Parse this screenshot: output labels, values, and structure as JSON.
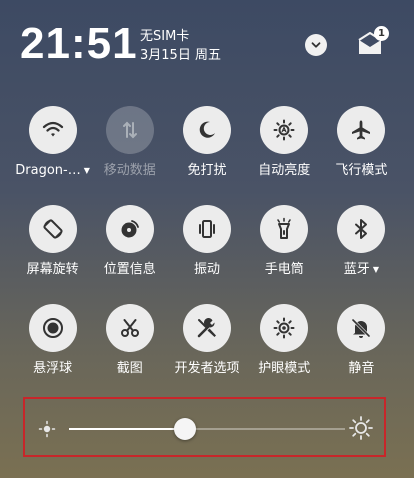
{
  "status": {
    "time": "21:51",
    "carrier": "无SIM卡",
    "date": "3月15日 周五",
    "notification_count": "1"
  },
  "tiles": [
    {
      "label": "Dragon-…",
      "icon": "wifi-icon",
      "active": true,
      "caret": true
    },
    {
      "label": "移动数据",
      "icon": "mobile-data-icon",
      "active": false,
      "caret": false
    },
    {
      "label": "免打扰",
      "icon": "moon-icon",
      "active": true,
      "caret": false
    },
    {
      "label": "自动亮度",
      "icon": "auto-brightness-icon",
      "active": true,
      "caret": false
    },
    {
      "label": "飞行模式",
      "icon": "airplane-icon",
      "active": true,
      "caret": false
    },
    {
      "label": "屏幕旋转",
      "icon": "rotate-icon",
      "active": true,
      "caret": false
    },
    {
      "label": "位置信息",
      "icon": "location-icon",
      "active": true,
      "caret": false
    },
    {
      "label": "振动",
      "icon": "vibrate-icon",
      "active": true,
      "caret": false
    },
    {
      "label": "手电筒",
      "icon": "flashlight-icon",
      "active": true,
      "caret": false
    },
    {
      "label": "蓝牙",
      "icon": "bluetooth-icon",
      "active": true,
      "caret": true
    },
    {
      "label": "悬浮球",
      "icon": "float-ball-icon",
      "active": true,
      "caret": false
    },
    {
      "label": "截图",
      "icon": "scissors-icon",
      "active": true,
      "caret": false
    },
    {
      "label": "开发者选项",
      "icon": "tools-icon",
      "active": true,
      "caret": false
    },
    {
      "label": "护眼模式",
      "icon": "eye-care-icon",
      "active": true,
      "caret": false
    },
    {
      "label": "静音",
      "icon": "bell-off-icon",
      "active": true,
      "caret": false
    }
  ],
  "brightness": {
    "level": 0.42,
    "highlight_color": "#c8262a"
  }
}
